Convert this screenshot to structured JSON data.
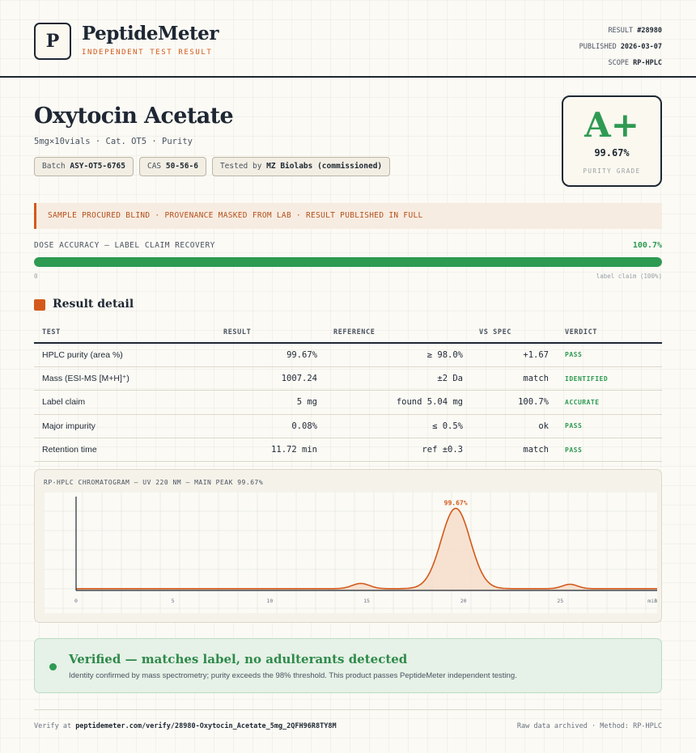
{
  "header": {
    "logo_letter": "P",
    "brand": "PeptideMeter",
    "brand_sub": "INDEPENDENT TEST RESULT",
    "result_label": "RESULT",
    "result_value": "#28980",
    "published_label": "PUBLISHED",
    "published_value": "2026-03-07",
    "scope_label": "SCOPE",
    "scope_value": "RP-HPLC"
  },
  "product": {
    "title": "Oxytocin Acetate",
    "subtitle": "5mg×10vials · Cat. OT5 · Purity",
    "chips": [
      {
        "label": "Batch",
        "value": "ASY-OT5-6765"
      },
      {
        "label": "CAS",
        "value": "50-56-6"
      },
      {
        "label": "Tested by",
        "value": "MZ Biolabs (commissioned)"
      }
    ]
  },
  "grade": {
    "letter": "A+",
    "value": "99.67%",
    "label": "PURITY GRADE"
  },
  "notice": "SAMPLE PROCURED BLIND · PROVENANCE MASKED FROM LAB · RESULT PUBLISHED IN FULL",
  "dose": {
    "label": "DOSE ACCURACY — LABEL CLAIM RECOVERY",
    "value": "100.7%",
    "fill_percent": 100,
    "min_label": "0",
    "max_label": "label claim (100%)"
  },
  "section_title": "Result detail",
  "table": {
    "headers": [
      "TEST",
      "RESULT",
      "REFERENCE",
      "VS SPEC",
      "VERDICT"
    ],
    "rows": [
      {
        "test": "HPLC purity (area %)",
        "result": "99.67%",
        "reference": "≥ 98.0%",
        "vs_spec": "+1.67",
        "verdict": "PASS"
      },
      {
        "test": "Mass (ESI-MS [M+H]⁺)",
        "result": "1007.24",
        "reference": "±2 Da",
        "vs_spec": "match",
        "verdict": "IDENTIFIED"
      },
      {
        "test": "Label claim",
        "result": "5 mg",
        "reference": "found 5.04 mg",
        "vs_spec": "100.7%",
        "verdict": "ACCURATE"
      },
      {
        "test": "Major impurity",
        "result": "0.08%",
        "reference": "≤ 0.5%",
        "vs_spec": "ok",
        "verdict": "PASS"
      },
      {
        "test": "Retention time",
        "result": "11.72 min",
        "reference": "ref ±0.3",
        "vs_spec": "match",
        "verdict": "PASS"
      }
    ]
  },
  "chart_data": {
    "type": "line",
    "title": "RP-HPLC CHROMATOGRAM — UV 220 NM — MAIN PEAK 99.67%",
    "xlabel": "",
    "ylabel": "",
    "x_ticks": [
      "0",
      "5",
      "10",
      "15",
      "20",
      "25",
      "30"
    ],
    "x_unit": "min",
    "xlim": [
      0,
      30
    ],
    "ylim": [
      0,
      100
    ],
    "grid": true,
    "peaks": [
      {
        "center": 14.7,
        "height": 6,
        "width": 0.45
      },
      {
        "center": 19.6,
        "height": 92,
        "width": 0.75
      },
      {
        "center": 25.5,
        "height": 5,
        "width": 0.4
      }
    ],
    "baseline": 2,
    "peak_label": "99.67%",
    "colors": {
      "line": "#d35a1a",
      "fill": "#f6dcc8",
      "axis": "#1e2733"
    }
  },
  "verified": {
    "title": "Verified — matches label, no adulterants detected",
    "subtitle": "Identity confirmed by mass spectrometry; purity exceeds the 98% threshold. This product passes PeptideMeter independent testing."
  },
  "footer": {
    "verify_label": "Verify at",
    "verify_url": "peptidemeter.com/verify/28980-Oxytocin_Acetate_5mg_2QFH96R8TY8M",
    "right": "Raw data archived · Method: RP-HPLC"
  },
  "colors": {
    "accent": "#d35a1a",
    "pass": "#2e9a52",
    "ink": "#1e2733"
  }
}
